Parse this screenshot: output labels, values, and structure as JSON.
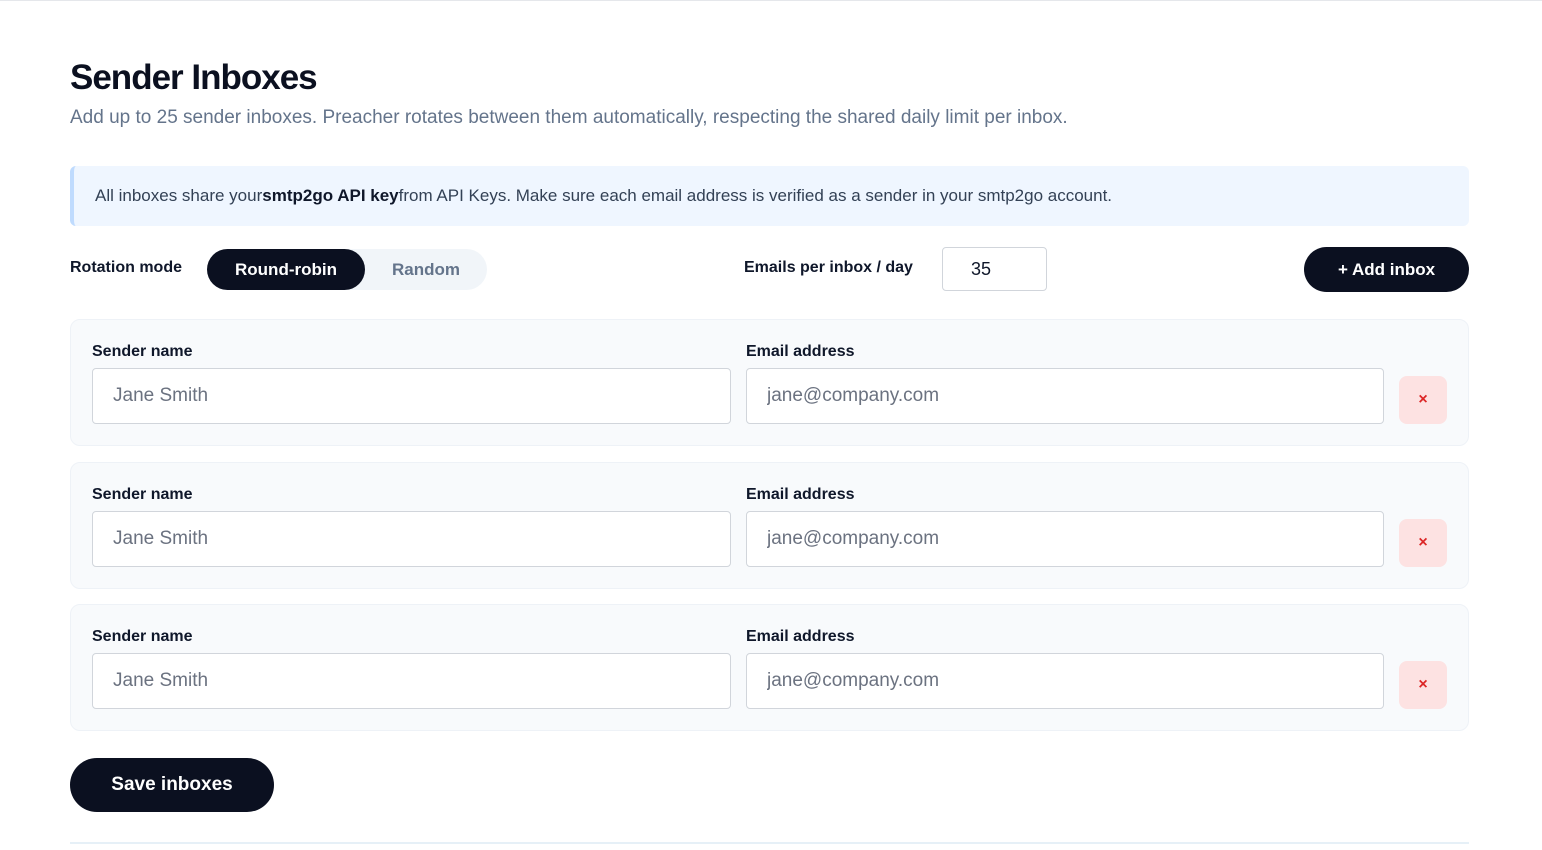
{
  "header": {
    "title": "Sender Inboxes",
    "subtitle": "Add up to 25 sender inboxes. Preacher rotates between them automatically, respecting the shared daily limit per inbox."
  },
  "notice": {
    "prefix": "All inboxes share your ",
    "bold": "smtp2go API key",
    "suffix": " from API Keys. Make sure each email address is verified as a sender in your smtp2go account."
  },
  "controls": {
    "rotation_label": "Rotation mode",
    "rotation_options": [
      {
        "label": "Round-robin",
        "selected": true
      },
      {
        "label": "Random",
        "selected": false
      }
    ],
    "per_day_label": "Emails per inbox / day",
    "per_day_value": "35",
    "add_label": "+ Add inbox"
  },
  "inboxes": [
    {
      "name_label": "Sender name",
      "name_value": "",
      "name_placeholder": "Jane Smith",
      "email_label": "Email address",
      "email_value": "",
      "email_placeholder": "jane@company.com",
      "remove_label": "×"
    },
    {
      "name_label": "Sender name",
      "name_value": "",
      "name_placeholder": "Jane Smith",
      "email_label": "Email address",
      "email_value": "",
      "email_placeholder": "jane@company.com",
      "remove_label": "×"
    },
    {
      "name_label": "Sender name",
      "name_value": "",
      "name_placeholder": "Jane Smith",
      "email_label": "Email address",
      "email_value": "",
      "email_placeholder": "jane@company.com",
      "remove_label": "×"
    }
  ],
  "footer": {
    "save_label": "Save inboxes"
  },
  "colors": {
    "primary": "#0b1020",
    "notice_bg": "#eff6ff",
    "remove_bg": "#fde2e2",
    "remove_fg": "#dc2626"
  },
  "icons": {
    "remove": "close-icon"
  }
}
